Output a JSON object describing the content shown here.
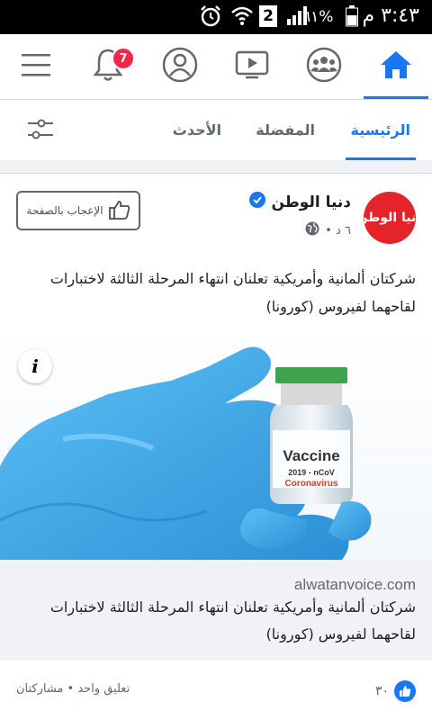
{
  "status_bar": {
    "time": "٣:٤٣ م",
    "battery": "٦١%",
    "sim": "2"
  },
  "top_nav": {
    "notifications_badge": "7",
    "items": [
      "home-icon",
      "groups-icon",
      "watch-icon",
      "profile-icon",
      "notifications-icon",
      "menu-icon"
    ]
  },
  "tabs": {
    "home": "الرئيسية",
    "favorites": "المفضلة",
    "recent": "الأحدث"
  },
  "post": {
    "page_name": "دنيا الوطن",
    "avatar_text": "دنيا الوطن",
    "time": "٦ د •",
    "like_page_label": "الإعجاب بالصفحة",
    "text": "شركتان ألمانية وأمريكية تعلنان انتهاء المرحلة الثالثة لاختبارات لقاحهما لفيروس (كورونا)",
    "image": {
      "vial_label": "Vaccine",
      "vial_sub1": "2019 - nCoV",
      "vial_sub2": "Coronavirus",
      "info_label": "i"
    },
    "link": {
      "domain": "alwatanvoice.com",
      "title": "شركتان ألمانية وأمريكية تعلنان انتهاء المرحلة الثالثة لاختبارات لقاحهما لفيروس (كورونا)"
    },
    "reactions_count": "٣٠",
    "comments_shares": "تعليق واحد • مشاركتان"
  },
  "colors": {
    "accent": "#1877f2",
    "badge": "#f02849",
    "avatar_bg": "#e52329",
    "glove": "#3ea6e6"
  }
}
